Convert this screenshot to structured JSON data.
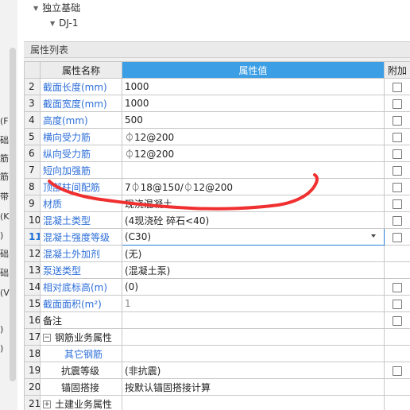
{
  "left_strip": {
    "labels": [
      "(F",
      "础",
      "筋",
      "筋",
      "带",
      "(K",
      ")",
      "础",
      "础",
      "(V",
      ")",
      ")"
    ]
  },
  "tree": {
    "node1": "独立基础",
    "node2": "DJ-1"
  },
  "panel": {
    "title": "属性列表",
    "col_name": "属性名称",
    "col_value": "属性值",
    "col_attach": "附加"
  },
  "rows": [
    {
      "n": "2",
      "name": "截面长度(mm)",
      "value": "1000",
      "check": true
    },
    {
      "n": "3",
      "name": "截面宽度(mm)",
      "value": "1000",
      "check": true
    },
    {
      "n": "4",
      "name": "高度(mm)",
      "value": "500",
      "check": true
    },
    {
      "n": "5",
      "name": "横向受力筋",
      "value": "⏀12@200",
      "check": true
    },
    {
      "n": "6",
      "name": "纵向受力筋",
      "value": "⏀12@200",
      "check": true
    },
    {
      "n": "7",
      "name": "短向加强筋",
      "value": "",
      "check": true
    },
    {
      "n": "8",
      "name": "顶部柱间配筋",
      "value": "7⏀18@150/⏀12@200",
      "check": true
    },
    {
      "n": "9",
      "name": "材质",
      "value": "现浇混凝土",
      "check": true
    },
    {
      "n": "10",
      "name": "混凝土类型",
      "value": "(4现浇砼 碎石<40)",
      "check": true
    },
    {
      "n": "11",
      "name": "混凝土强度等级",
      "value": "(C30)",
      "check": true
    },
    {
      "n": "12",
      "name": "混凝土外加剂",
      "value": "(无)",
      "check": false
    },
    {
      "n": "13",
      "name": "泵送类型",
      "value": "(混凝土泵)",
      "check": false
    },
    {
      "n": "14",
      "name": "相对底标高(m)",
      "value": "(0)",
      "check": true
    },
    {
      "n": "15",
      "name": "截面面积(m²)",
      "value": "1",
      "check": true
    },
    {
      "n": "16",
      "name": "备注",
      "value": "",
      "check": true
    },
    {
      "n": "17",
      "name": "钢筋业务属性",
      "value": "",
      "check": false
    },
    {
      "n": "18",
      "name": "其它钢筋",
      "value": "",
      "check": false
    },
    {
      "n": "19",
      "name": "抗震等级",
      "value": "(非抗震)",
      "check": true
    },
    {
      "n": "20",
      "name": "锚固搭接",
      "value": "按默认锚固搭接计算",
      "check": false
    },
    {
      "n": "21",
      "name": "土建业务属性",
      "value": "",
      "check": false
    }
  ],
  "colors": {
    "header_highlight": "#3c9ee5",
    "link_blue": "#2c6ed8",
    "scribble_red": "#f03030"
  }
}
